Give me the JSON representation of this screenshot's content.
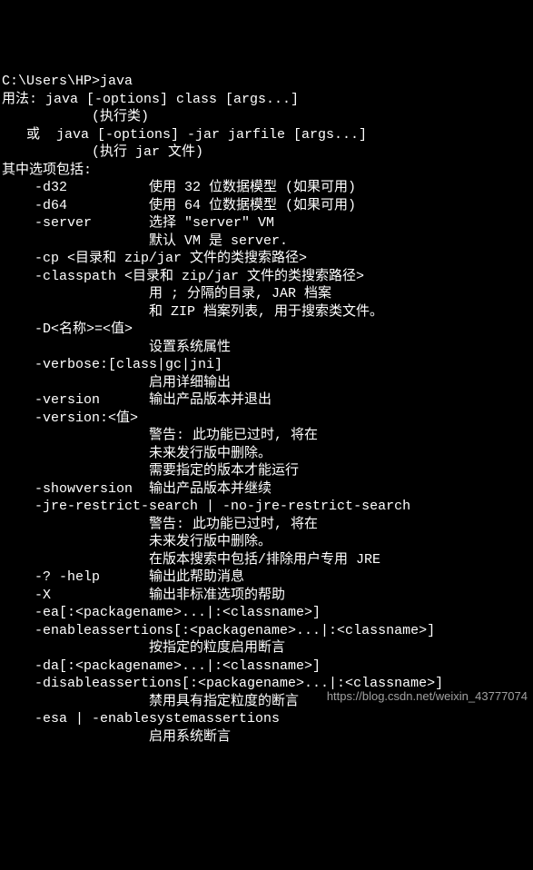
{
  "terminal": {
    "lines": [
      "C:\\Users\\HP>java",
      "用法: java [-options] class [args...]",
      "           (执行类)",
      "   或  java [-options] -jar jarfile [args...]",
      "           (执行 jar 文件)",
      "其中选项包括:",
      "    -d32          使用 32 位数据模型 (如果可用)",
      "    -d64          使用 64 位数据模型 (如果可用)",
      "    -server       选择 \"server\" VM",
      "                  默认 VM 是 server.",
      "",
      "    -cp <目录和 zip/jar 文件的类搜索路径>",
      "    -classpath <目录和 zip/jar 文件的类搜索路径>",
      "                  用 ; 分隔的目录, JAR 档案",
      "                  和 ZIP 档案列表, 用于搜索类文件。",
      "    -D<名称>=<值>",
      "                  设置系统属性",
      "    -verbose:[class|gc|jni]",
      "                  启用详细输出",
      "    -version      输出产品版本并退出",
      "    -version:<值>",
      "                  警告: 此功能已过时, 将在",
      "                  未来发行版中删除。",
      "                  需要指定的版本才能运行",
      "    -showversion  输出产品版本并继续",
      "    -jre-restrict-search | -no-jre-restrict-search",
      "                  警告: 此功能已过时, 将在",
      "                  未来发行版中删除。",
      "                  在版本搜索中包括/排除用户专用 JRE",
      "    -? -help      输出此帮助消息",
      "    -X            输出非标准选项的帮助",
      "    -ea[:<packagename>...|:<classname>]",
      "    -enableassertions[:<packagename>...|:<classname>]",
      "                  按指定的粒度启用断言",
      "    -da[:<packagename>...|:<classname>]",
      "    -disableassertions[:<packagename>...|:<classname>]",
      "                  禁用具有指定粒度的断言",
      "    -esa | -enablesystemassertions",
      "                  启用系统断言"
    ]
  },
  "watermark": "https://blog.csdn.net/weixin_43777074"
}
